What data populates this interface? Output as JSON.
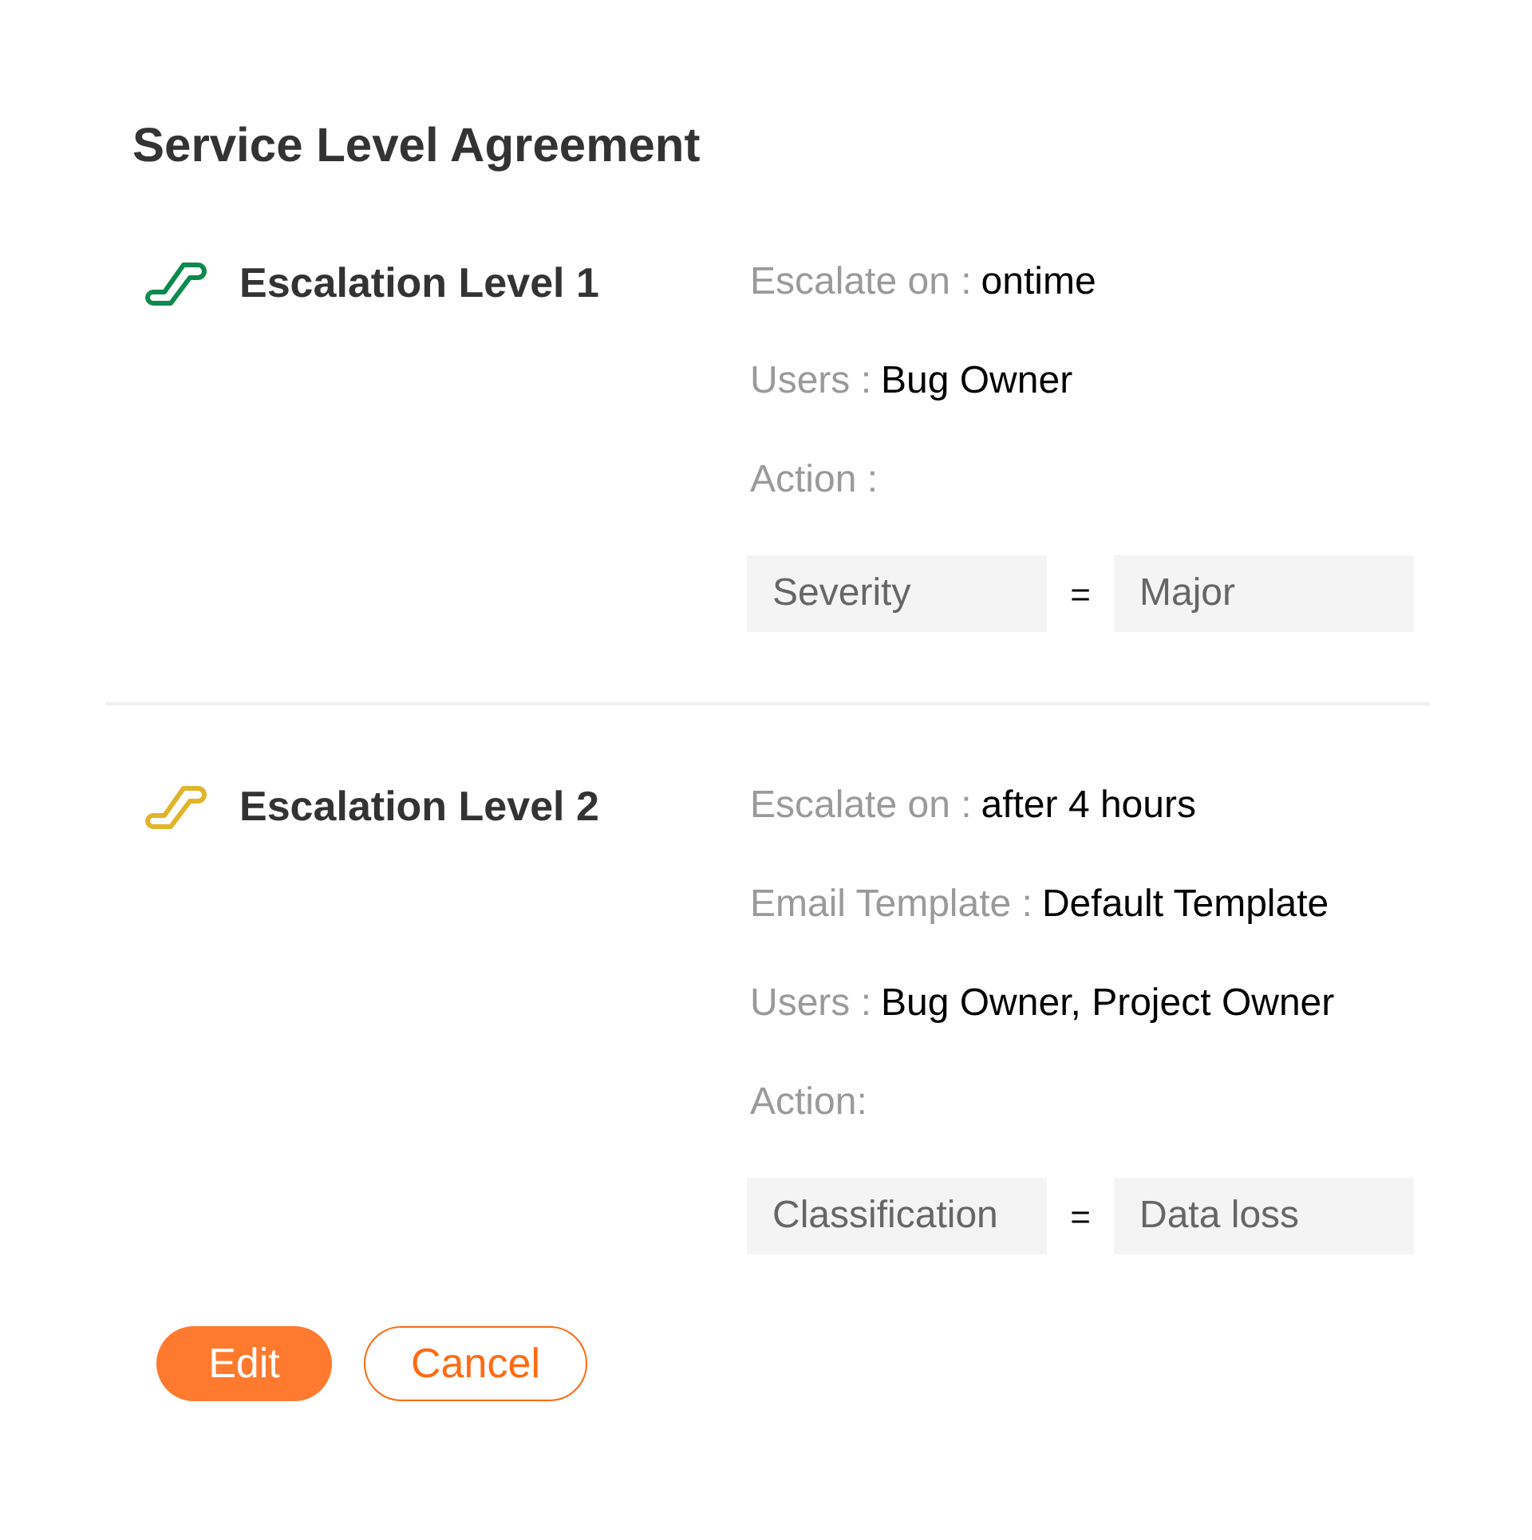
{
  "title": "Service Level Agreement",
  "levels": [
    {
      "title": "Escalation Level 1",
      "color": "#0f8a4f",
      "details": [
        {
          "label": "Escalate on :",
          "value": "ontime"
        },
        {
          "label": "Users :",
          "value": "Bug Owner"
        }
      ],
      "action_label": "Action :",
      "condition": {
        "field": "Severity",
        "operator": "=",
        "value": "Major"
      }
    },
    {
      "title": "Escalation Level 2",
      "color": "#e0b52a",
      "details": [
        {
          "label": "Escalate on :",
          "value": "after 4 hours"
        },
        {
          "label": "Email Template :",
          "value": "Default Template"
        },
        {
          "label": "Users :",
          "value": "Bug Owner, Project Owner"
        }
      ],
      "action_label": "Action:",
      "condition": {
        "field": "Classification",
        "operator": "=",
        "value": "Data loss"
      }
    }
  ],
  "buttons": [
    {
      "kind": "primary",
      "label": "Edit"
    },
    {
      "kind": "secondary",
      "label": "Cancel"
    }
  ]
}
